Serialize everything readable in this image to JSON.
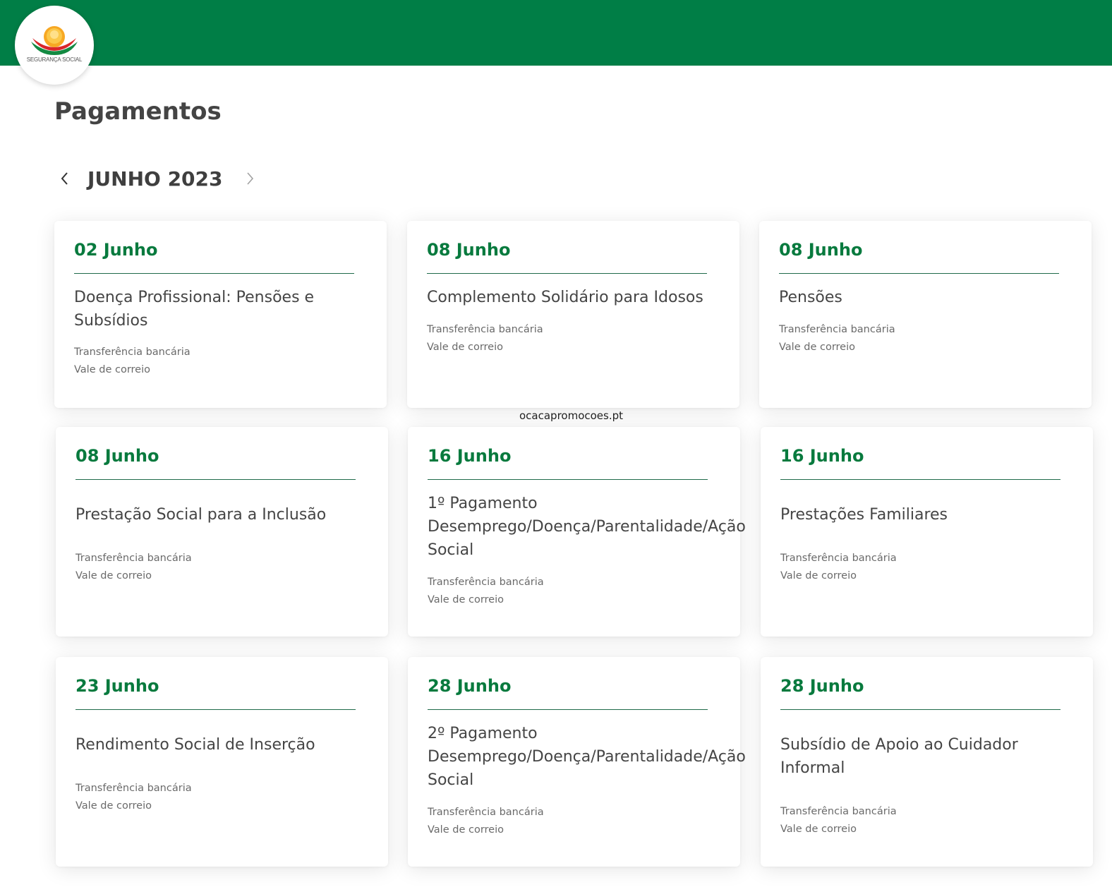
{
  "header": {
    "logo_text": "SEGURANÇA SOCIAL",
    "brand_color": "#007e46"
  },
  "page": {
    "title": "Pagamentos"
  },
  "month_nav": {
    "label": "JUNHO 2023",
    "prev_icon": "chevron-left-icon",
    "next_icon": "chevron-right-icon"
  },
  "watermark": "ocacapromocoes.pt",
  "accent_color": "#087a3e",
  "cards": [
    {
      "date": "02 Junho",
      "title": "Doença Profissional: Pensões e Subsídios",
      "methods": [
        "Transferência bancária",
        "Vale de correio"
      ]
    },
    {
      "date": "08 Junho",
      "title": "Complemento Solidário para Idosos",
      "methods": [
        "Transferência bancária",
        "Vale de correio"
      ]
    },
    {
      "date": "08 Junho",
      "title": "Pensões",
      "methods": [
        "Transferência bancária",
        "Vale de correio"
      ]
    },
    {
      "date": "08 Junho",
      "title": "Prestação Social para a Inclusão",
      "methods": [
        "Transferência bancária",
        "Vale de correio"
      ]
    },
    {
      "date": "16 Junho",
      "title": "1º Pagamento Desemprego/Doença/Parentalidade/Ação Social",
      "methods": [
        "Transferência bancária",
        "Vale de correio"
      ]
    },
    {
      "date": "16 Junho",
      "title": "Prestações Familiares",
      "methods": [
        "Transferência bancária",
        "Vale de correio"
      ]
    },
    {
      "date": "23 Junho",
      "title": "Rendimento Social de Inserção",
      "methods": [
        "Transferência bancária",
        "Vale de correio"
      ]
    },
    {
      "date": "28 Junho",
      "title": "2º Pagamento Desemprego/Doença/Parentalidade/Ação Social",
      "methods": [
        "Transferência bancária",
        "Vale de correio"
      ]
    },
    {
      "date": "28 Junho",
      "title": "Subsídio de Apoio ao Cuidador Informal",
      "methods": [
        "Transferência bancária",
        "Vale de correio"
      ]
    }
  ]
}
